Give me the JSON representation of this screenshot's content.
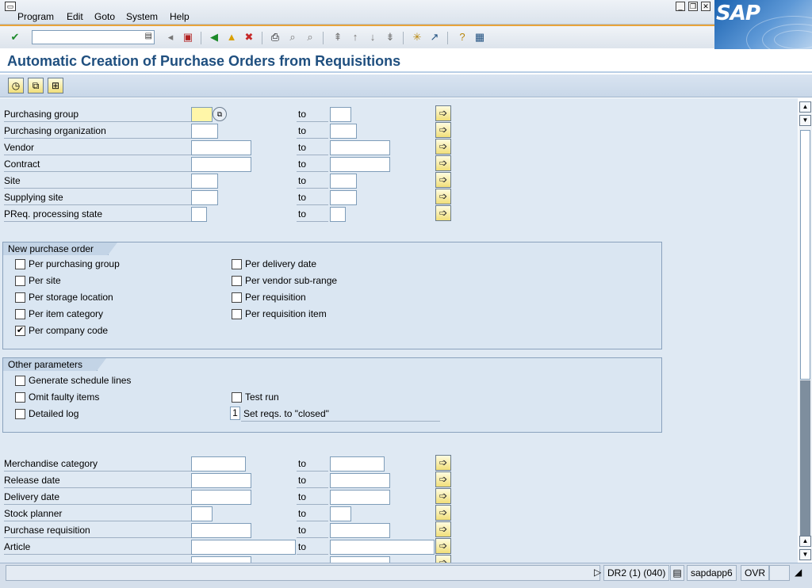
{
  "menu": {
    "items": [
      "Program",
      "Edit",
      "Goto",
      "System",
      "Help"
    ]
  },
  "logo": {
    "text": "SAP"
  },
  "page": {
    "title": "Automatic Creation of Purchase Orders from Requisitions"
  },
  "selection_rows": [
    {
      "label": "Purchasing group",
      "to": "to"
    },
    {
      "label": "Purchasing organization",
      "to": "to"
    },
    {
      "label": "Vendor",
      "to": "to"
    },
    {
      "label": "Contract",
      "to": "to"
    },
    {
      "label": "Site",
      "to": "to"
    },
    {
      "label": "Supplying site",
      "to": "to"
    },
    {
      "label": "PReq. processing state",
      "to": "to"
    }
  ],
  "new_po_group": {
    "title": "New purchase order",
    "options": [
      {
        "label": "Per purchasing group",
        "checked": false
      },
      {
        "label": "Per site",
        "checked": false
      },
      {
        "label": "Per storage location",
        "checked": false
      },
      {
        "label": "Per item category",
        "checked": false
      },
      {
        "label": "Per company code",
        "checked": true
      },
      {
        "label": "Per delivery date",
        "checked": false
      },
      {
        "label": "Per vendor sub-range",
        "checked": false
      },
      {
        "label": "Per requisition",
        "checked": false
      },
      {
        "label": "Per requisition item",
        "checked": false
      }
    ]
  },
  "other_params": {
    "title": "Other parameters",
    "generate_schedule_lines": "Generate schedule lines",
    "omit_faulty_items": "Omit faulty items",
    "detailed_log": "Detailed log",
    "test_run": "Test run",
    "set_reqs_value": "1",
    "set_reqs_label": "Set reqs. to \"closed\""
  },
  "lower_rows": [
    {
      "label": "Merchandise category",
      "to": "to"
    },
    {
      "label": "Release date",
      "to": "to"
    },
    {
      "label": "Delivery date",
      "to": "to"
    },
    {
      "label": "Stock planner",
      "to": "to"
    },
    {
      "label": "Purchase requisition",
      "to": "to"
    },
    {
      "label": "Article",
      "to": "to"
    }
  ],
  "status": {
    "system": "DR2 (1) (040)",
    "server": "sapdapp6",
    "mode": "OVR"
  }
}
